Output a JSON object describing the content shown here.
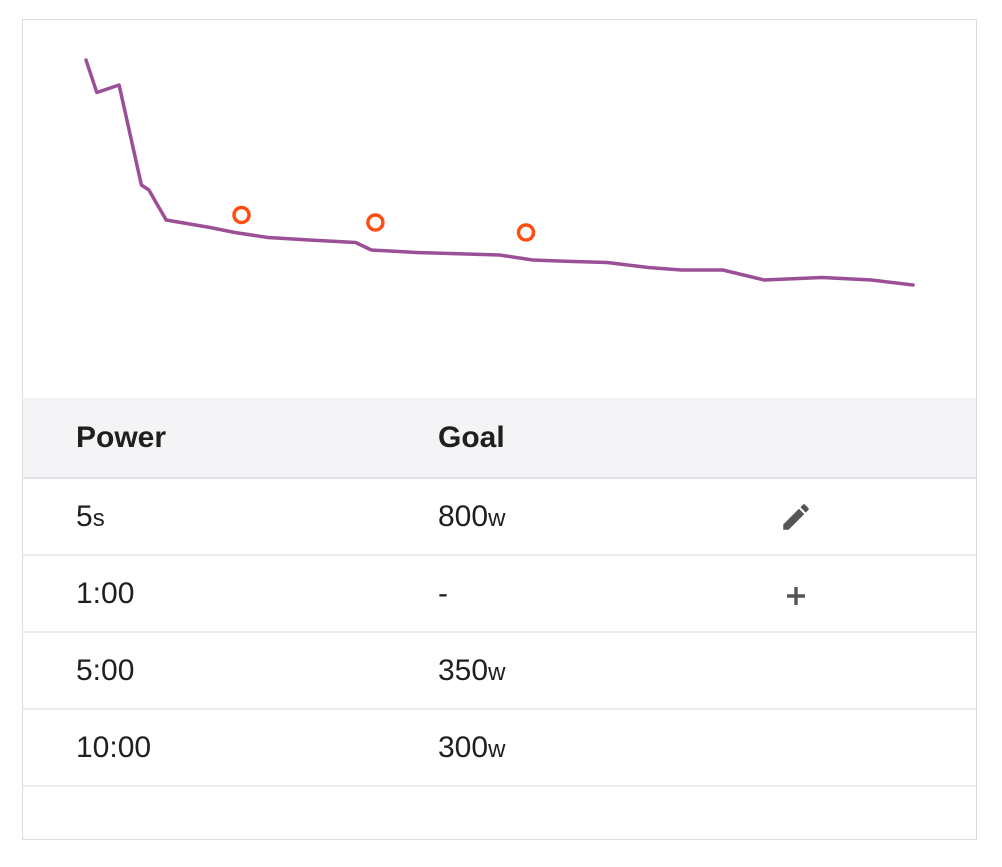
{
  "colors": {
    "line": "#9b4f96",
    "goal_marker": "#ff4d12",
    "header_bg": "#f4f4f6",
    "border": "#dcdce1",
    "icon": "#555555"
  },
  "chart_data": {
    "type": "line",
    "grid": false,
    "series": [
      {
        "values": [
          [
            0,
            1.0
          ],
          [
            0.013,
            0.87
          ],
          [
            0.04,
            0.9
          ],
          [
            0.067,
            0.5
          ],
          [
            0.076,
            0.48
          ],
          [
            0.083,
            0.44
          ],
          [
            0.097,
            0.36
          ],
          [
            0.15,
            0.33
          ],
          [
            0.18,
            0.31
          ],
          [
            0.22,
            0.29
          ],
          [
            0.27,
            0.28
          ],
          [
            0.326,
            0.27
          ],
          [
            0.345,
            0.24
          ],
          [
            0.4,
            0.23
          ],
          [
            0.45,
            0.225
          ],
          [
            0.5,
            0.22
          ],
          [
            0.54,
            0.2
          ],
          [
            0.58,
            0.195
          ],
          [
            0.63,
            0.19
          ],
          [
            0.68,
            0.17
          ],
          [
            0.72,
            0.16
          ],
          [
            0.77,
            0.16
          ],
          [
            0.82,
            0.12
          ],
          [
            0.89,
            0.13
          ],
          [
            0.95,
            0.12
          ],
          [
            1.0,
            0.1
          ]
        ]
      }
    ],
    "goals": [
      {
        "x": 0.188,
        "y": 0.38
      },
      {
        "x": 0.35,
        "y": 0.35
      },
      {
        "x": 0.532,
        "y": 0.31
      }
    ]
  },
  "table": {
    "headers": {
      "power": "Power",
      "goal": "Goal"
    },
    "rows": [
      {
        "duration": "5",
        "duration_unit": "s",
        "goal": "800",
        "goal_unit": "w",
        "action_icon": "pencil-icon"
      },
      {
        "duration": "1:00",
        "duration_unit": "",
        "goal": "-",
        "goal_unit": "",
        "action_icon": "plus-icon"
      },
      {
        "duration": "5:00",
        "duration_unit": "",
        "goal": "350",
        "goal_unit": "w",
        "action_icon": ""
      },
      {
        "duration": "10:00",
        "duration_unit": "",
        "goal": "300",
        "goal_unit": "w",
        "action_icon": ""
      }
    ]
  }
}
